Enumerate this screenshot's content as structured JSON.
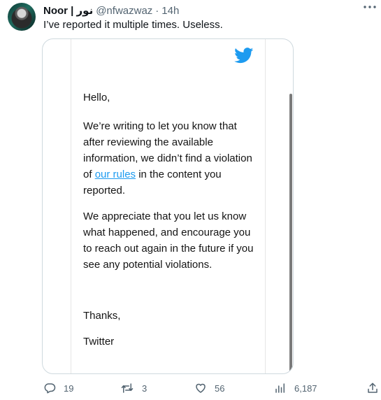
{
  "tweet": {
    "author_name": "Noor | نور",
    "handle": "@nfwazwaz",
    "separator": "·",
    "time": "14h",
    "text": "I’ve reported it multiple times. Useless."
  },
  "email": {
    "greeting": "Hello,",
    "p1_before": "We’re writing to let you know that after reviewing the available information, we didn’t find a violation of ",
    "p1_link": "our rules",
    "p1_after": " in the content you reported.",
    "p2": "We appreciate that you let us know what happened, and encourage you to reach out again in the future if you see any potential violations.",
    "thanks": "Thanks,",
    "signature": "Twitter",
    "brand_color": "#1d9bf0"
  },
  "actions": {
    "replies": "19",
    "retweets": "3",
    "likes": "56",
    "views": "6,187"
  },
  "icons": [
    "more-icon",
    "twitter-bird-icon",
    "reply-icon",
    "retweet-icon",
    "like-icon",
    "views-icon",
    "share-icon"
  ]
}
